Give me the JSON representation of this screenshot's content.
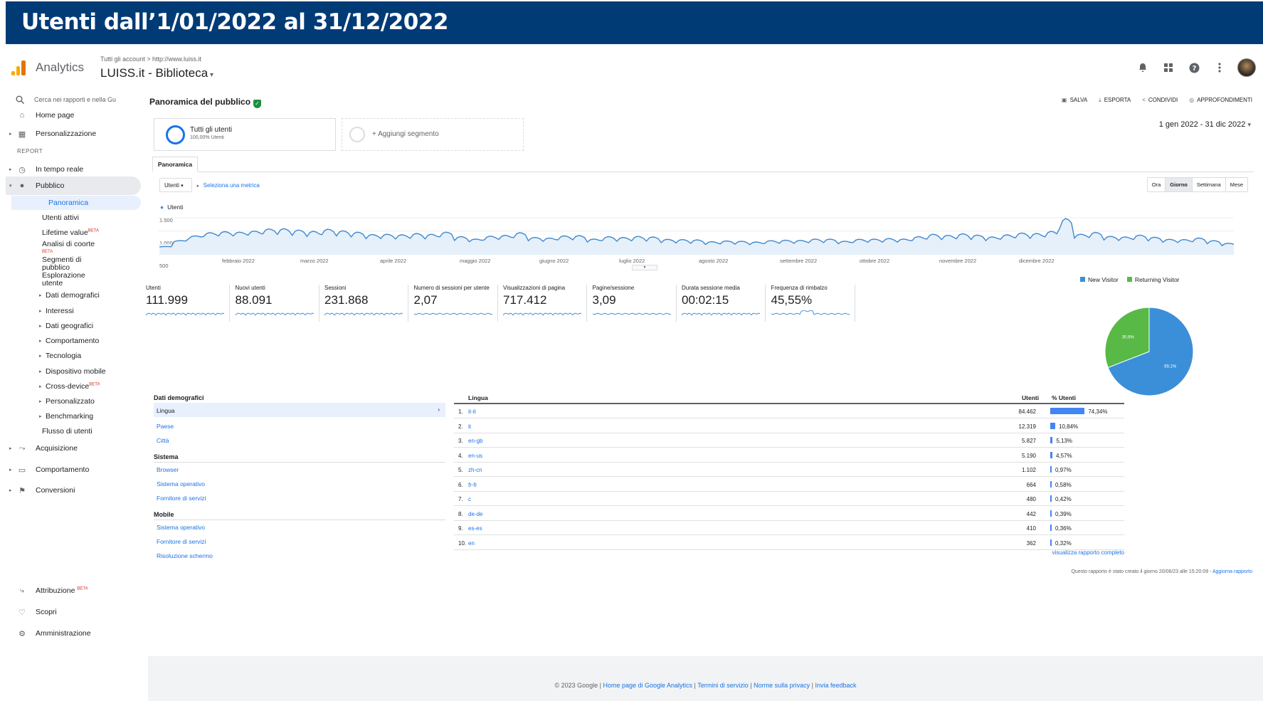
{
  "banner": {
    "title": "Utenti dall’1/01/2022 al 31/12/2022"
  },
  "header": {
    "app_name": "Analytics",
    "breadcrumb": "Tutti gli account > http://www.luiss.it",
    "property": "LUISS.it - Biblioteca",
    "icons": [
      "bell-icon",
      "apps-icon",
      "help-icon",
      "more-icon"
    ]
  },
  "sidebar": {
    "search_placeholder": "Cerca nei rapporti e nella Gu",
    "home": "Home page",
    "customization": "Personalizzazione",
    "report_heading": "REPORT",
    "realtime": "In tempo reale",
    "audience": "Pubblico",
    "audience_items": {
      "overview": "Panoramica",
      "active_users": "Utenti attivi",
      "lifetime": "Lifetime value",
      "cohort": "Analisi di coorte",
      "segments": "Segmenti di pubblico",
      "explorer": "Esplorazione utente",
      "demographics": "Dati demografici",
      "interests": "Interessi",
      "geo": "Dati geografici",
      "behavior": "Comportamento",
      "technology": "Tecnologia",
      "mobile": "Dispositivo mobile",
      "cross_device": "Cross-device",
      "custom": "Personalizzato",
      "benchmarking": "Benchmarking",
      "users_flow": "Flusso di utenti"
    },
    "beta": "BETA",
    "acquisition": "Acquisizione",
    "behavior": "Comportamento",
    "conversions": "Conversioni",
    "attribution": "Attribuzione",
    "discover": "Scopri",
    "admin": "Amministrazione"
  },
  "main": {
    "title": "Panoramica del pubblico",
    "actions": [
      "SALVA",
      "ESPORTA",
      "CONDIVIDI",
      "APPROFONDIMENTI"
    ],
    "segment_all": "Tutti gli utenti",
    "segment_all_sub": "100,00% Utenti",
    "segment_add": "+ Aggiungi segmento",
    "date_range": "1 gen 2022 - 31 dic 2022",
    "tab": "Panoramica",
    "metric_dropdown": "Utenti",
    "metric_select": "Seleziona una metrica",
    "granularity": [
      "Ora",
      "Giorno",
      "Settimana",
      "Mese"
    ],
    "granularity_selected": "Giorno"
  },
  "chart_data": {
    "type": "area",
    "series": [
      {
        "name": "Utenti"
      }
    ],
    "y_ticks": [
      "1.500",
      "1.000",
      "500"
    ],
    "ylim": [
      0,
      1800
    ],
    "x_labels": [
      "febbraio 2022",
      "marzo 2022",
      "aprile 2022",
      "maggio 2022",
      "giugno 2022",
      "luglio 2022",
      "agosto 2022",
      "settembre 2022",
      "ottobre 2022",
      "novembre 2022",
      "dicembre 2022"
    ],
    "weekly_peaks": [
      420,
      640,
      820,
      940,
      980,
      960,
      1000,
      1080,
      1090,
      1040,
      990,
      1070,
      1010,
      960,
      870,
      880,
      860,
      910,
      880,
      960,
      790,
      700,
      810,
      840,
      940,
      760,
      740,
      820,
      830,
      700,
      790,
      760,
      800,
      780,
      690,
      680,
      670,
      600,
      630,
      620,
      590,
      640,
      660,
      650,
      700,
      700,
      620,
      690,
      700,
      720,
      700,
      790,
      880,
      840,
      900,
      850,
      780,
      860,
      930,
      910,
      990,
      1470,
      880,
      950,
      800,
      780,
      850,
      770,
      690,
      680,
      740,
      640,
      540
    ],
    "weekly_lows": [
      380,
      560,
      600,
      620,
      610,
      640,
      650,
      660,
      610,
      590,
      560,
      600,
      580,
      560,
      520,
      520,
      510,
      500,
      490,
      560,
      470,
      470,
      480,
      500,
      520,
      480,
      460,
      480,
      470,
      450,
      450,
      440,
      430,
      430,
      410,
      400,
      380,
      370,
      380,
      370,
      360,
      390,
      390,
      400,
      400,
      400,
      400,
      420,
      430,
      420,
      440,
      460,
      470,
      480,
      480,
      480,
      470,
      490,
      510,
      500,
      520,
      640,
      560,
      520,
      500,
      480,
      480,
      460,
      440,
      430,
      420,
      380,
      340
    ],
    "kpis": [
      {
        "label": "Utenti",
        "value": "111.999"
      },
      {
        "label": "Nuovi utenti",
        "value": "88.091"
      },
      {
        "label": "Sessioni",
        "value": "231.868"
      },
      {
        "label": "Numero di sessioni per utente",
        "value": "2,07"
      },
      {
        "label": "Visualizzazioni di pagina",
        "value": "717.412"
      },
      {
        "label": "Pagine/sessione",
        "value": "3,09"
      },
      {
        "label": "Durata sessione media",
        "value": "00:02:15"
      },
      {
        "label": "Frequenza di rimbalzo",
        "value": "45,55%"
      }
    ],
    "pie": {
      "type": "pie",
      "legend": [
        "New Visitor",
        "Returning Visitor"
      ],
      "values": [
        69.1,
        30.9
      ],
      "labels": [
        "69,1%",
        "30,9%"
      ],
      "colors": [
        "#3b8fd9",
        "#58b947"
      ]
    }
  },
  "demographics": {
    "heading": "Dati demografici",
    "selected": "Lingua",
    "items": [
      "Paese",
      "Città"
    ],
    "system_heading": "Sistema",
    "system_items": [
      "Browser",
      "Sistema operativo",
      "Fornitore di servizi"
    ],
    "mobile_heading": "Mobile",
    "mobile_items": [
      "Sistema operativo",
      "Fornitore di servizi",
      "Risoluzione schermo"
    ]
  },
  "language_table": {
    "heading": "Lingua",
    "col_users": "Utenti",
    "col_pct": "% Utenti",
    "rows": [
      {
        "n": "1.",
        "name": "it-it",
        "users": "84.462",
        "pct": "74,34%",
        "frac": 0.7434
      },
      {
        "n": "2.",
        "name": "it",
        "users": "12.319",
        "pct": "10,84%",
        "frac": 0.1084
      },
      {
        "n": "3.",
        "name": "en-gb",
        "users": "5.827",
        "pct": "5,13%",
        "frac": 0.0513
      },
      {
        "n": "4.",
        "name": "en-us",
        "users": "5.190",
        "pct": "4,57%",
        "frac": 0.0457
      },
      {
        "n": "5.",
        "name": "zh-cn",
        "users": "1.102",
        "pct": "0,97%",
        "frac": 0.0097
      },
      {
        "n": "6.",
        "name": "fr-fr",
        "users": "664",
        "pct": "0,58%",
        "frac": 0.0058
      },
      {
        "n": "7.",
        "name": "c",
        "users": "480",
        "pct": "0,42%",
        "frac": 0.0042
      },
      {
        "n": "8.",
        "name": "de-de",
        "users": "442",
        "pct": "0,39%",
        "frac": 0.0039
      },
      {
        "n": "9.",
        "name": "es-es",
        "users": "410",
        "pct": "0,36%",
        "frac": 0.0036
      },
      {
        "n": "10.",
        "name": "en",
        "users": "362",
        "pct": "0,32%",
        "frac": 0.0032
      }
    ],
    "more_link": "visualizza rapporto completo"
  },
  "report_created": "Questo rapporto è stato creato il giorno 20/06/23 alle 15:20:09 - ",
  "report_refresh": "Aggiorna rapporto",
  "footer": {
    "copyright": "© 2023 Google | ",
    "links": [
      "Home page di Google Analytics",
      "Termini di servizio",
      "Norme sulla privacy",
      "Invia feedback"
    ]
  }
}
